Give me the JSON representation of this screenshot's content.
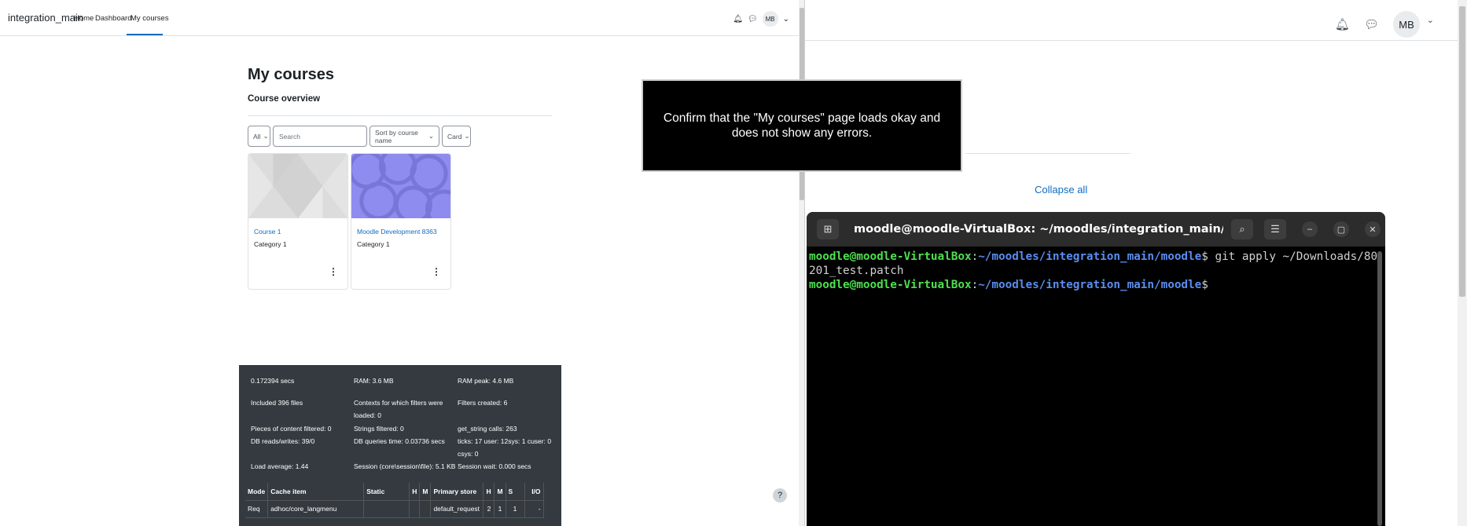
{
  "left": {
    "brand": "integration_main",
    "nav": [
      "Home",
      "Dashboard",
      "My courses"
    ],
    "user_initials": "MB",
    "page_title": "My courses",
    "section_title": "Course overview",
    "filters": {
      "grouping": "All",
      "search_placeholder": "Search",
      "sort": "Sort by course name",
      "view": "Card"
    },
    "courses": [
      {
        "name": "Course 1",
        "category": "Category 1"
      },
      {
        "name": "Moodle Development 8363",
        "category": "Category 1"
      }
    ],
    "perf": {
      "secs": "0.172394 secs",
      "ram": "RAM: 3.6 MB",
      "ram_peak": "RAM peak: 4.6 MB",
      "included": "Included 396 files",
      "contexts": "Contexts for which filters were loaded: 0",
      "filters_created": "Filters created: 6",
      "pieces": "Pieces of content filtered: 0",
      "strings": "Strings filtered: 0",
      "get_string": "get_string calls: 263",
      "db_rw": "DB reads/writes: 39/0",
      "db_time": "DB queries time: 0.03736 secs",
      "ticks": "ticks: 17 user: 12sys: 1 cuser: 0 csys: 0",
      "load": "Load average: 1.44",
      "session": "Session (core\\session\\file): 5.1 KB",
      "session_wait": "Session wait: 0.000 secs",
      "table_headers": [
        "Mode",
        "Cache item",
        "Static",
        "H",
        "M",
        "Primary store",
        "H",
        "M",
        "S",
        "I/O"
      ],
      "table_row": [
        "Req",
        "adhoc/core_langmenu",
        "",
        "",
        "",
        "default_request",
        "2",
        "1",
        "1",
        "-"
      ]
    },
    "help": "?"
  },
  "right": {
    "user_initials": "MB",
    "collapse_all": "Collapse all"
  },
  "overlay": {
    "text": "Confirm that the \"My courses\" page loads okay and does not show any errors."
  },
  "terminal": {
    "title": "moodle@moodle-VirtualBox: ~/moodles/integration_main/...",
    "user_host": "moodle@moodle-VirtualBox",
    "path": "~/moodles/integration_main/moodle",
    "command": "git apply ~/Downloads/80201_test.patch"
  }
}
